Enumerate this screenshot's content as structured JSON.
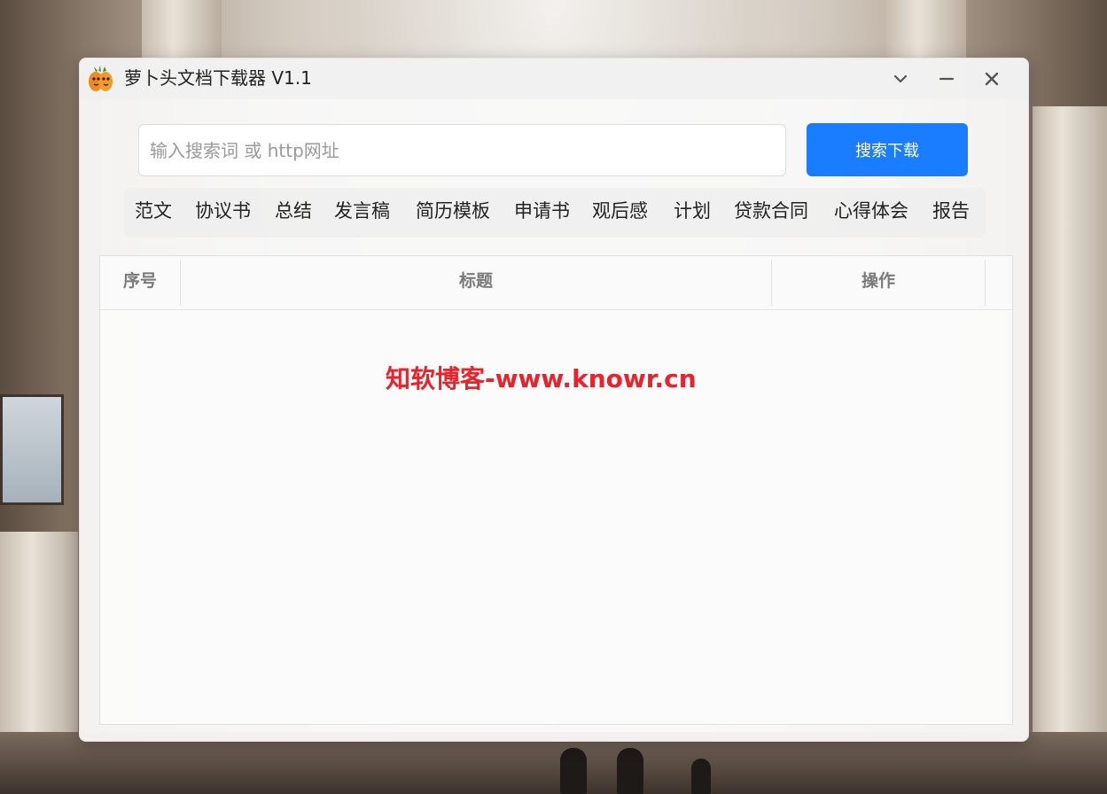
{
  "window": {
    "title": "萝卜头文档下载器  V1.1",
    "icon": "carrot-logo"
  },
  "controls": {
    "dropdown_icon": "chevron-down-icon",
    "minimize_icon": "minimize-icon",
    "close_icon": "close-icon"
  },
  "search": {
    "placeholder": "输入搜索词 或 http网址",
    "value": "",
    "button_label": "搜索下载"
  },
  "categories": [
    "范文",
    "协议书",
    "总结",
    "发言稿",
    "简历模板",
    "申请书",
    "观后感",
    "计划",
    "贷款合同",
    "心得体会",
    "报告"
  ],
  "table": {
    "columns": [
      "序号",
      "标题",
      "操作"
    ],
    "rows": []
  },
  "watermark": "知软博客-www.knowr.cn",
  "colors": {
    "accent": "#1a7cff",
    "watermark": "#e8232b"
  }
}
